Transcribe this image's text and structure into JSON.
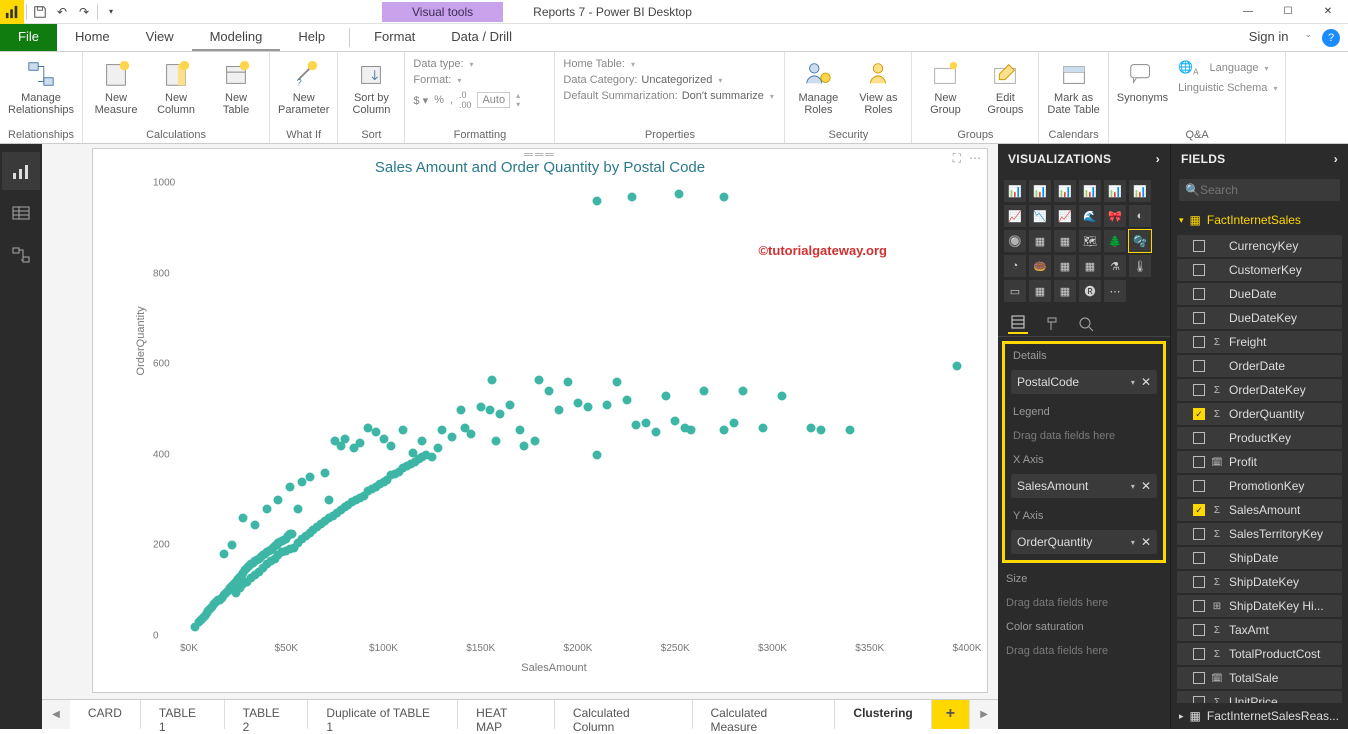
{
  "app_title": "Reports 7 - Power BI Desktop",
  "visual_tools_label": "Visual tools",
  "titlebar_icons": {
    "save": "save-icon",
    "undo": "undo-icon",
    "redo": "redo-icon"
  },
  "window_buttons": [
    "—",
    "☐",
    "✕"
  ],
  "menu": {
    "file": "File",
    "tabs": [
      "Home",
      "View",
      "Modeling",
      "Help",
      "Format",
      "Data / Drill"
    ],
    "active": "Modeling",
    "signin": "Sign in"
  },
  "ribbon": {
    "relationships": {
      "label": "Relationships",
      "manage": "Manage\nRelationships"
    },
    "calculations": {
      "label": "Calculations",
      "new_measure": "New\nMeasure",
      "new_column": "New\nColumn",
      "new_table": "New\nTable"
    },
    "whatif": {
      "label": "What If",
      "new_parameter": "New\nParameter"
    },
    "sort": {
      "label": "Sort",
      "sort_by": "Sort by\nColumn"
    },
    "formatting": {
      "label": "Formatting",
      "data_type": "Data type:",
      "format": "Format:",
      "auto": "Auto"
    },
    "properties": {
      "label": "Properties",
      "home_table": "Home Table:",
      "data_category": "Data Category:",
      "data_category_val": "Uncategorized",
      "default_sum": "Default Summarization:",
      "default_sum_val": "Don't summarize"
    },
    "security": {
      "label": "Security",
      "manage_roles": "Manage\nRoles",
      "view_as": "View as\nRoles"
    },
    "groups": {
      "label": "Groups",
      "new_group": "New\nGroup",
      "edit_groups": "Edit\nGroups"
    },
    "calendars": {
      "label": "Calendars",
      "mark_as": "Mark as\nDate Table"
    },
    "qa": {
      "label": "Q&A",
      "synonyms": "Synonyms",
      "language": "Language",
      "schema": "Linguistic Schema"
    }
  },
  "pages": [
    "CARD",
    "TABLE 1",
    "TABLE 2",
    "Duplicate of TABLE 1",
    "HEAT MAP",
    "Calculated Column",
    "Calculated Measure",
    "Clustering"
  ],
  "active_page": "Clustering",
  "viz_panel": {
    "title": "VISUALIZATIONS",
    "wells": {
      "details": "Details",
      "details_field": "PostalCode",
      "legend": "Legend",
      "legend_hint": "Drag data fields here",
      "xaxis": "X Axis",
      "xaxis_field": "SalesAmount",
      "yaxis": "Y Axis",
      "yaxis_field": "OrderQuantity",
      "size": "Size",
      "size_hint": "Drag data fields here",
      "color": "Color saturation",
      "color_hint": "Drag data fields here"
    }
  },
  "fields_panel": {
    "title": "FIELDS",
    "search_placeholder": "Search",
    "table": "FactInternetSales",
    "table2": "FactInternetSalesReas...",
    "fields": [
      {
        "name": "CurrencyKey",
        "checked": false,
        "type": ""
      },
      {
        "name": "CustomerKey",
        "checked": false,
        "type": ""
      },
      {
        "name": "DueDate",
        "checked": false,
        "type": ""
      },
      {
        "name": "DueDateKey",
        "checked": false,
        "type": ""
      },
      {
        "name": "Freight",
        "checked": false,
        "type": "sigma"
      },
      {
        "name": "OrderDate",
        "checked": false,
        "type": ""
      },
      {
        "name": "OrderDateKey",
        "checked": false,
        "type": "sigma"
      },
      {
        "name": "OrderQuantity",
        "checked": true,
        "type": "sigma"
      },
      {
        "name": "ProductKey",
        "checked": false,
        "type": ""
      },
      {
        "name": "Profit",
        "checked": false,
        "type": "calc"
      },
      {
        "name": "PromotionKey",
        "checked": false,
        "type": ""
      },
      {
        "name": "SalesAmount",
        "checked": true,
        "type": "sigma"
      },
      {
        "name": "SalesTerritoryKey",
        "checked": false,
        "type": "sigma"
      },
      {
        "name": "ShipDate",
        "checked": false,
        "type": ""
      },
      {
        "name": "ShipDateKey",
        "checked": false,
        "type": "sigma"
      },
      {
        "name": "ShipDateKey Hi...",
        "checked": false,
        "type": "hier"
      },
      {
        "name": "TaxAmt",
        "checked": false,
        "type": "sigma"
      },
      {
        "name": "TotalProductCost",
        "checked": false,
        "type": "sigma"
      },
      {
        "name": "TotalSale",
        "checked": false,
        "type": "calc"
      },
      {
        "name": "UnitPrice",
        "checked": false,
        "type": "sigma"
      }
    ]
  },
  "watermark": "©tutorialgateway.org",
  "chart_data": {
    "type": "scatter",
    "title": "Sales Amount and Order Quantity by Postal Code",
    "xlabel": "SalesAmount",
    "ylabel": "OrderQuantity",
    "xlim": [
      0,
      400000
    ],
    "ylim": [
      0,
      1000
    ],
    "xticks": [
      0,
      50000,
      100000,
      150000,
      200000,
      250000,
      300000,
      350000,
      400000
    ],
    "xticklabels": [
      "$0K",
      "$50K",
      "$100K",
      "$150K",
      "$200K",
      "$250K",
      "$300K",
      "$350K",
      "$400K"
    ],
    "yticks": [
      0,
      200,
      400,
      600,
      800,
      1000
    ],
    "series": [
      {
        "name": "PostalCode",
        "color": "#3db6a6",
        "values": [
          [
            3000,
            20
          ],
          [
            5000,
            30
          ],
          [
            6000,
            35
          ],
          [
            7000,
            40
          ],
          [
            8000,
            45
          ],
          [
            9000,
            50
          ],
          [
            10000,
            55
          ],
          [
            11000,
            60
          ],
          [
            12000,
            65
          ],
          [
            13000,
            70
          ],
          [
            14000,
            75
          ],
          [
            15000,
            80
          ],
          [
            16000,
            80
          ],
          [
            17000,
            85
          ],
          [
            18000,
            90
          ],
          [
            19000,
            95
          ],
          [
            20000,
            100
          ],
          [
            21000,
            105
          ],
          [
            22000,
            110
          ],
          [
            23000,
            115
          ],
          [
            24000,
            120
          ],
          [
            25000,
            125
          ],
          [
            26000,
            130
          ],
          [
            27000,
            135
          ],
          [
            28000,
            140
          ],
          [
            29000,
            145
          ],
          [
            30000,
            150
          ],
          [
            31000,
            155
          ],
          [
            32000,
            160
          ],
          [
            33000,
            162
          ],
          [
            34000,
            165
          ],
          [
            35000,
            168
          ],
          [
            36000,
            170
          ],
          [
            37000,
            175
          ],
          [
            38000,
            178
          ],
          [
            39000,
            180
          ],
          [
            40000,
            185
          ],
          [
            41000,
            188
          ],
          [
            42000,
            190
          ],
          [
            43000,
            195
          ],
          [
            44000,
            198
          ],
          [
            45000,
            200
          ],
          [
            46000,
            205
          ],
          [
            47000,
            208
          ],
          [
            48000,
            210
          ],
          [
            49000,
            213
          ],
          [
            50000,
            215
          ],
          [
            51000,
            220
          ],
          [
            52000,
            225
          ],
          [
            53000,
            225
          ],
          [
            24000,
            95
          ],
          [
            26000,
            105
          ],
          [
            28000,
            115
          ],
          [
            30000,
            120
          ],
          [
            32000,
            128
          ],
          [
            34000,
            135
          ],
          [
            36000,
            142
          ],
          [
            38000,
            150
          ],
          [
            40000,
            158
          ],
          [
            42000,
            165
          ],
          [
            44000,
            170
          ],
          [
            46000,
            178
          ],
          [
            48000,
            185
          ],
          [
            50000,
            188
          ],
          [
            52000,
            192
          ],
          [
            54000,
            195
          ],
          [
            56000,
            205
          ],
          [
            58000,
            215
          ],
          [
            60000,
            220
          ],
          [
            62000,
            228
          ],
          [
            64000,
            235
          ],
          [
            66000,
            240
          ],
          [
            68000,
            248
          ],
          [
            70000,
            255
          ],
          [
            72000,
            260
          ],
          [
            74000,
            265
          ],
          [
            76000,
            272
          ],
          [
            78000,
            278
          ],
          [
            80000,
            285
          ],
          [
            82000,
            290
          ],
          [
            84000,
            295
          ],
          [
            86000,
            300
          ],
          [
            88000,
            305
          ],
          [
            90000,
            310
          ],
          [
            92000,
            320
          ],
          [
            94000,
            325
          ],
          [
            96000,
            330
          ],
          [
            98000,
            335
          ],
          [
            100000,
            340
          ],
          [
            102000,
            345
          ],
          [
            104000,
            355
          ],
          [
            106000,
            358
          ],
          [
            108000,
            362
          ],
          [
            110000,
            370
          ],
          [
            112000,
            375
          ],
          [
            114000,
            380
          ],
          [
            116000,
            385
          ],
          [
            118000,
            390
          ],
          [
            120000,
            395
          ],
          [
            122000,
            400
          ],
          [
            70000,
            360
          ],
          [
            72000,
            300
          ],
          [
            75000,
            430
          ],
          [
            78000,
            420
          ],
          [
            80000,
            435
          ],
          [
            85000,
            415
          ],
          [
            88000,
            425
          ],
          [
            92000,
            460
          ],
          [
            96000,
            450
          ],
          [
            100000,
            435
          ],
          [
            104000,
            420
          ],
          [
            110000,
            455
          ],
          [
            115000,
            405
          ],
          [
            120000,
            430
          ],
          [
            125000,
            395
          ],
          [
            128000,
            415
          ],
          [
            130000,
            455
          ],
          [
            135000,
            440
          ],
          [
            140000,
            500
          ],
          [
            142000,
            460
          ],
          [
            145000,
            445
          ],
          [
            150000,
            505
          ],
          [
            155000,
            500
          ],
          [
            156000,
            565
          ],
          [
            158000,
            430
          ],
          [
            160000,
            490
          ],
          [
            165000,
            510
          ],
          [
            170000,
            455
          ],
          [
            172000,
            420
          ],
          [
            178000,
            430
          ],
          [
            180000,
            565
          ],
          [
            185000,
            540
          ],
          [
            190000,
            500
          ],
          [
            195000,
            560
          ],
          [
            200000,
            515
          ],
          [
            205000,
            505
          ],
          [
            210000,
            400
          ],
          [
            215000,
            510
          ],
          [
            220000,
            560
          ],
          [
            225000,
            520
          ],
          [
            230000,
            465
          ],
          [
            235000,
            470
          ],
          [
            240000,
            450
          ],
          [
            245000,
            530
          ],
          [
            250000,
            475
          ],
          [
            255000,
            460
          ],
          [
            258000,
            455
          ],
          [
            265000,
            540
          ],
          [
            275000,
            455
          ],
          [
            280000,
            470
          ],
          [
            285000,
            540
          ],
          [
            295000,
            460
          ],
          [
            305000,
            530
          ],
          [
            320000,
            460
          ],
          [
            325000,
            455
          ],
          [
            340000,
            455
          ],
          [
            395000,
            595
          ],
          [
            210000,
            960
          ],
          [
            228000,
            970
          ],
          [
            252000,
            975
          ],
          [
            275000,
            970
          ],
          [
            18000,
            180
          ],
          [
            22000,
            200
          ],
          [
            28000,
            260
          ],
          [
            34000,
            245
          ],
          [
            40000,
            280
          ],
          [
            46000,
            300
          ],
          [
            52000,
            330
          ],
          [
            56000,
            280
          ],
          [
            58000,
            340
          ],
          [
            62000,
            350
          ]
        ]
      }
    ]
  }
}
